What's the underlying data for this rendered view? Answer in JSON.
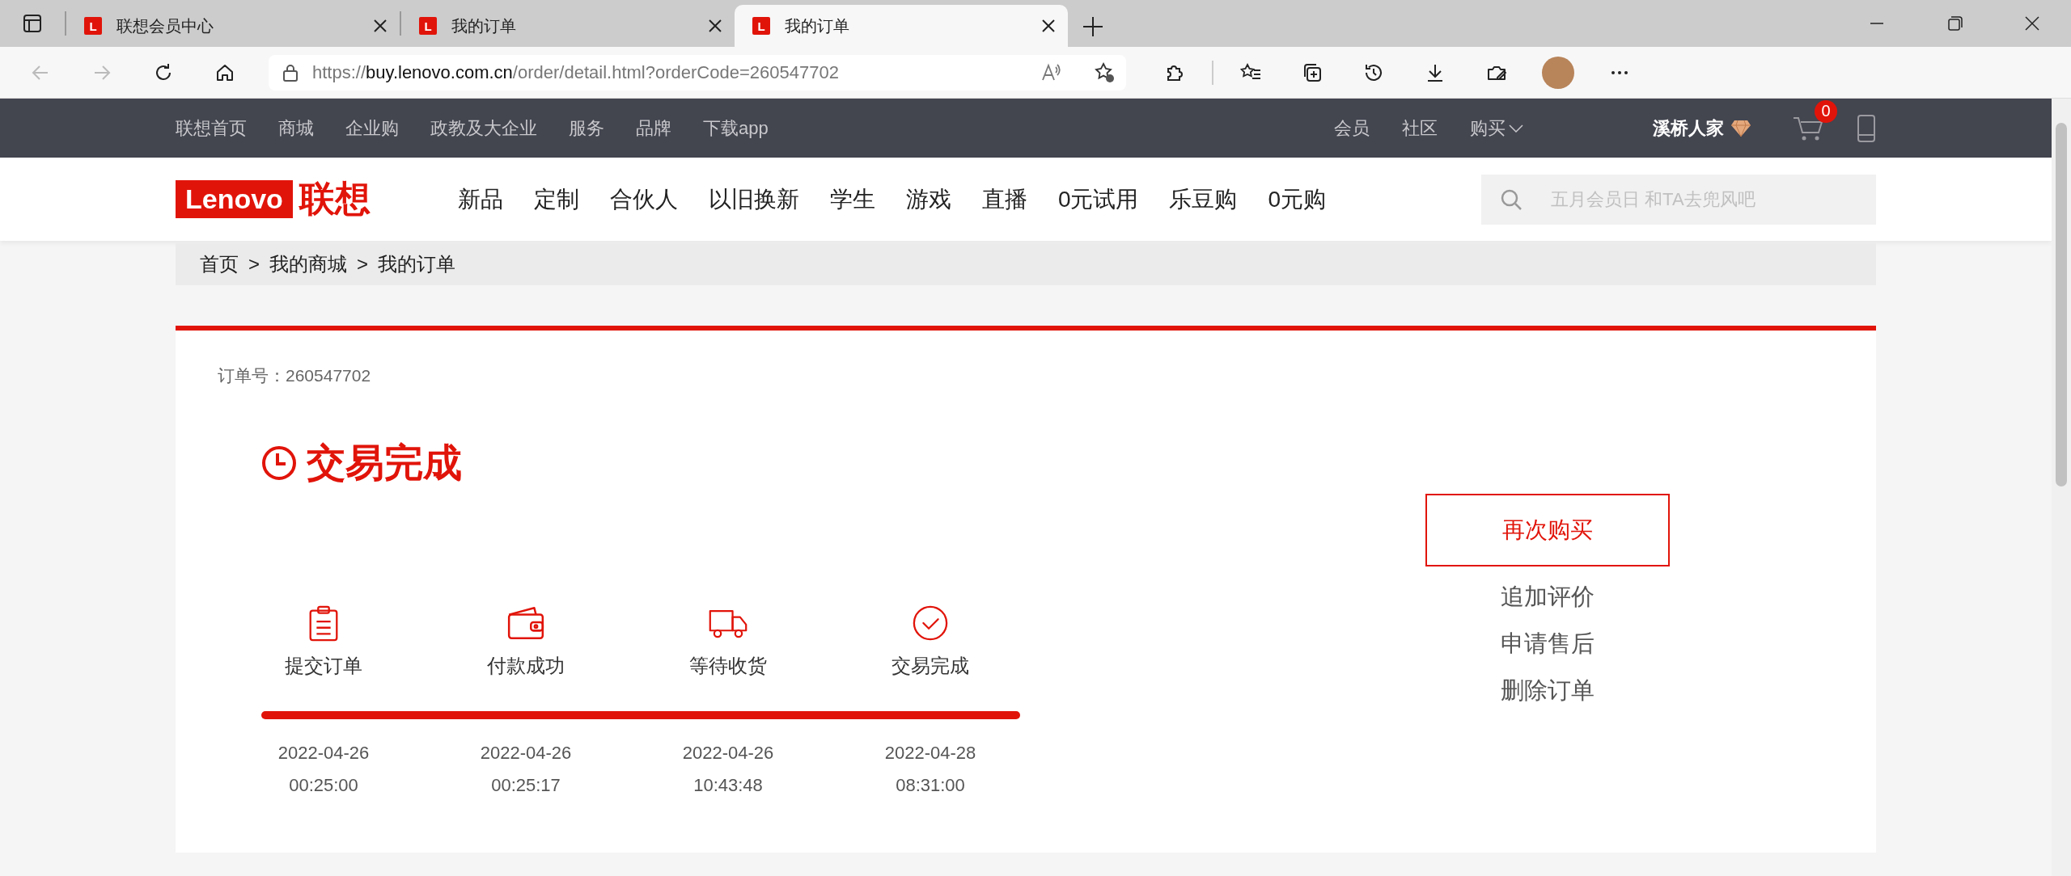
{
  "browser": {
    "tabs": [
      {
        "favicon": "L",
        "title": "联想会员中心",
        "selected": false
      },
      {
        "favicon": "L",
        "title": "我的订单",
        "selected": false
      },
      {
        "favicon": "L",
        "title": "我的订单",
        "selected": true
      }
    ],
    "url": {
      "scheme": "https://",
      "host": "buy.lenovo.com.cn",
      "path": "/order/detail.html?orderCode=260547702"
    }
  },
  "top_nav": {
    "left": [
      "联想首页",
      "商城",
      "企业购",
      "政教及大企业",
      "服务",
      "品牌",
      "下载app"
    ],
    "right": [
      "会员",
      "社区",
      "购买"
    ],
    "user": "溪桥人家",
    "cart_count": "0"
  },
  "header": {
    "logo_text": "Lenovo",
    "logo_cn": "联想",
    "nav": [
      "新品",
      "定制",
      "合伙人",
      "以旧换新",
      "学生",
      "游戏",
      "直播",
      "0元试用",
      "乐豆购",
      "0元购"
    ],
    "search": {
      "placeholder": "五月会员日 和TA去兜风吧"
    }
  },
  "breadcrumb": [
    {
      "label": "首页"
    },
    {
      "separator": ">",
      "label": "我的商城"
    },
    {
      "separator": ">",
      "label": "我的订单"
    }
  ],
  "order": {
    "number_label": "订单号：260547702",
    "status": "交易完成",
    "steps": [
      {
        "kind": "clipboard",
        "label": "提交订单",
        "date": "2022-04-26",
        "time": "00:25:00"
      },
      {
        "kind": "wallet",
        "label": "付款成功",
        "date": "2022-04-26",
        "time": "00:25:17"
      },
      {
        "kind": "truck",
        "label": "等待收货",
        "date": "2022-04-26",
        "time": "10:43:48"
      },
      {
        "kind": "check",
        "label": "交易完成",
        "date": "2022-04-28",
        "time": "08:31:00"
      }
    ],
    "progress": {
      "level": 1
    },
    "primary_action": "再次购买",
    "actions": [
      "追加评价",
      "申请售后",
      "删除订单"
    ]
  }
}
